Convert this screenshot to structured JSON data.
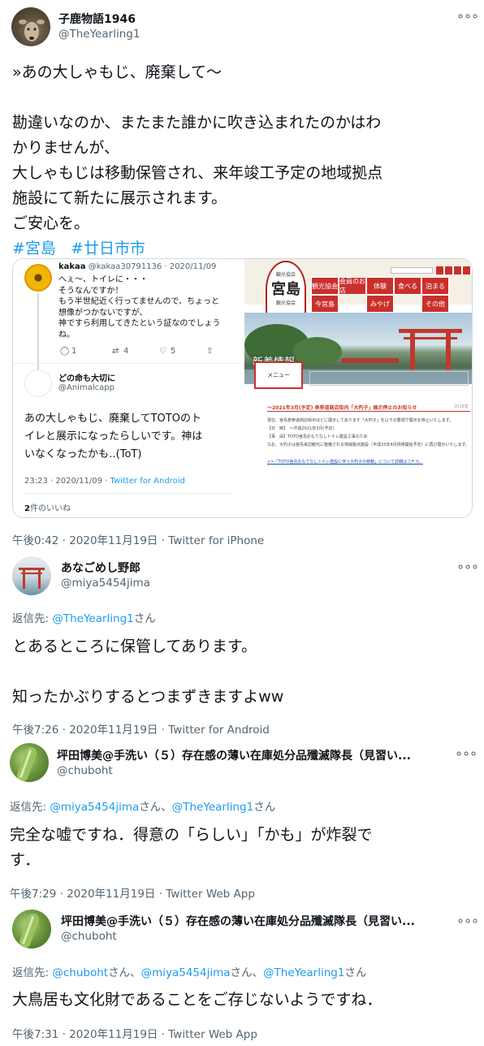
{
  "colors": {
    "link": "#1d9bf0",
    "secondary": "#536471",
    "border": "#cfd9de"
  },
  "tweet1": {
    "display_name": "子鹿物語1946",
    "handle": "@TheYearling1",
    "more_icon": "more-icon",
    "lines": [
      "»あの大しゃもじ、廃棄して〜",
      "",
      "勘違いなのか、またまた誰かに吹き込まれたのかはわ",
      "かりませんが、",
      "大しゃもじは移動保管され、来年竣工予定の地域拠点",
      "施設にて新たに展示されます。",
      "ご安心を。"
    ],
    "hashtags": [
      "#宮島",
      "#廿日市市"
    ],
    "timestamp": "午後0:42 · 2020年11月19日 · Twitter for iPhone"
  },
  "quoted_screenshot": {
    "reply1": {
      "name": "kakaa",
      "handle_date": "@kakaa30791136 · 2020/11/09",
      "lines": [
        "へぇ〜、トイレに・・・",
        "そうなんですか！",
        "もう半世紀近く行ってませんので、ちょっと",
        "想像がつかないですが、",
        "神ですら利用してきたという証なのでしょう",
        "ね。"
      ],
      "reply_count": "1",
      "retweet_count": "4",
      "like_count": "5"
    },
    "reply2": {
      "name": "どの命も大切に",
      "handle": "@Animalcapp",
      "lines": [
        "あの大しゃもじ、廃棄してTOTOのト",
        "イレと展示になったらしいです。神は",
        "いなくなったかも‥(ToT)"
      ],
      "time": "23:23 · 2020/11/09 · ",
      "client": "Twitter for Android",
      "likes_count": "2",
      "likes_label": "件のいいね"
    },
    "site": {
      "logo_small": "観光協会",
      "logo_big": "宮島",
      "logo_sub": "観光協会",
      "nav": [
        "観光協会",
        "会員のお店",
        "体験",
        "食べる",
        "泊まる",
        "今宮島",
        "みやげ",
        "その他"
      ],
      "banner_text": "新着情報",
      "menu_label": "メニュー",
      "notice_title": "〜2021年3月(予定) 表参道商店街内「大杓子」展示停止のお知らせ",
      "notice_date": "2019年",
      "notice_lines": [
        "現在、宮島表参道商店街中ほどに展示してあります「大杓子」を以下の要領で展示を停止いたします。",
        "【日　時】　〜平成2021年3月(予定)",
        "【事　由】TOTO宮島おもてなしトイレ建設工事のため",
        "なお、大杓子は宮島来訪観光に整備される地域拠点施設（平成33年4月供用開始予定）に再び展示いたします。"
      ],
      "notice_link": ">>「TOTO宮島おもてなしトイレ建設に伴う大杓子の移動」について詳細はコチラ。"
    }
  },
  "tweet2": {
    "display_name": "あなごめし野郎",
    "handle": "@miya5454jima",
    "reply_label": "返信先: ",
    "reply_to": "@TheYearling1",
    "reply_suffix": "さん",
    "lines": [
      "とあるところに保管してあります。",
      "",
      "知ったかぶりするとつまずきますよww"
    ],
    "timestamp": "午後7:26 · 2020年11月19日 · Twitter for Android"
  },
  "tweet3": {
    "display_name": "坪田博美@手洗い（５）存在感の薄い在庫処分品殲滅隊長（見習い...",
    "handle": "@chuboht",
    "reply_label": "返信先: ",
    "reply_to_1": "@miya5454jima",
    "reply_mid": "さん、",
    "reply_to_2": "@TheYearling1",
    "reply_suffix": "さん",
    "lines": [
      "完全な嘘ですね．得意の「らしい」「かも」が炸裂で",
      "す．"
    ],
    "timestamp": "午後7:29 · 2020年11月19日 · Twitter Web App"
  },
  "tweet4": {
    "display_name": "坪田博美@手洗い（５）存在感の薄い在庫処分品殲滅隊長（見習い...",
    "handle": "@chuboht",
    "reply_label": "返信先: ",
    "reply_to_1": "@chuboht",
    "reply_mid_1": "さん、",
    "reply_to_2": "@miya5454jima",
    "reply_mid_2": "さん、",
    "reply_to_3": "@TheYearling1",
    "reply_suffix": "さん",
    "lines": [
      "大鳥居も文化財であることをご存じないようですね．"
    ],
    "timestamp": "午後7:31 · 2020年11月19日 · Twitter Web App"
  }
}
